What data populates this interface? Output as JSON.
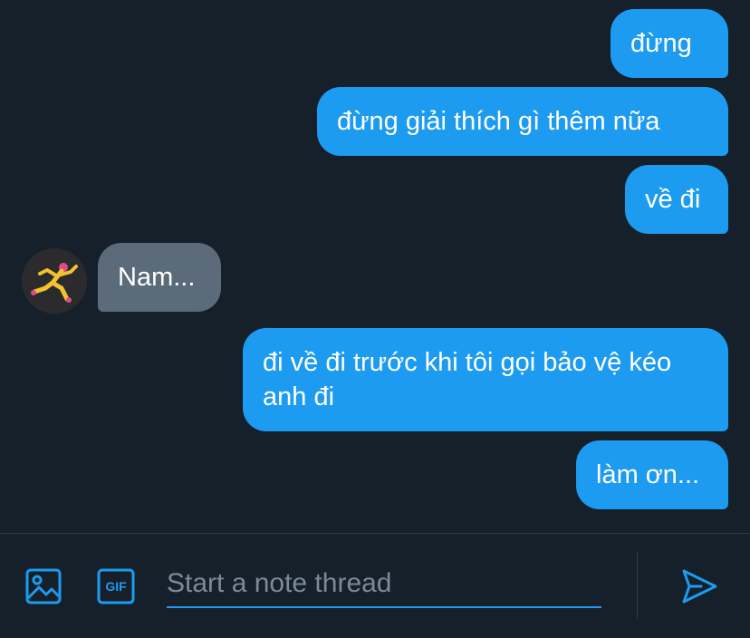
{
  "messages": [
    {
      "direction": "out",
      "text": "đừng"
    },
    {
      "direction": "out",
      "text": "đừng giải thích gì thêm nữa"
    },
    {
      "direction": "out",
      "text": "về đi"
    },
    {
      "direction": "in",
      "text": "Nam..."
    },
    {
      "direction": "out",
      "text": "đi về đi trước khi tôi gọi bảo vệ kéo anh đi"
    },
    {
      "direction": "out",
      "text": "làm ơn..."
    }
  ],
  "composer": {
    "placeholder": "Start a note thread",
    "media_icon": "image-icon",
    "gif_icon": "gif-icon",
    "gif_label": "GIF",
    "send_icon": "send-icon"
  },
  "colors": {
    "background": "#15202b",
    "outgoing_bubble": "#1d9bf0",
    "incoming_bubble": "#5b6b7a",
    "accent": "#1d9bf0"
  }
}
